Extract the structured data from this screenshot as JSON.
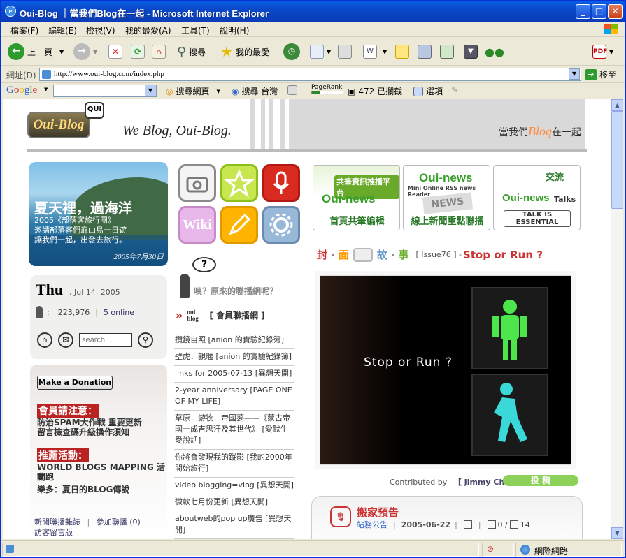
{
  "window": {
    "title": "Oui-Blog ｜當我們Blog在一起 - Microsoft Internet Explorer"
  },
  "menu": [
    "檔案(F)",
    "編輯(E)",
    "檢視(V)",
    "我的最愛(A)",
    "工具(T)",
    "說明(H)"
  ],
  "toolbar": {
    "back": "上一頁",
    "search": "搜尋",
    "favorites": "我的最愛"
  },
  "address": {
    "label": "網址(D)",
    "url": "http://www.oui-blog.com/index.php",
    "go": "移至"
  },
  "google": {
    "logo": "Google",
    "search_web": "搜尋網頁",
    "search_tw": "搜尋 台灣",
    "pagerank": "PageRank",
    "blocked": "472 已攔截",
    "options": "選項"
  },
  "status": {
    "zone": "網際網路"
  },
  "page": {
    "logo_text": "Oui-Blog",
    "logo_mark": "QUI",
    "slogan": "We Blog, Oui-Blog.",
    "tagline_pre": "當我們",
    "tagline_blog": "Blog",
    "tagline_post": "在一起",
    "banner": {
      "title": "夏天裡，過海洋",
      "line1": "2005《部落客旅行團》",
      "line2": "邀請部落客們龜山島一日遊",
      "line3": "讓我們一起，出發去旅行。",
      "date": "2005年7月30日"
    },
    "date": {
      "day": "Thu",
      "full": ", Jul 14, 2005",
      "users": "223,976",
      "online": "5 online",
      "search_placeholder": "search..."
    },
    "donate": "Make a Donation",
    "notice1_head": "會員請注意：",
    "notice1_line1": "防治SPAM大作戰 重要更新",
    "notice1_line2": "留言檢查碼升級操作須知",
    "notice2_head": "推薦活動：",
    "notice2_line1": "WORLD BLOGS MAPPING 活動",
    "notice2_line2": "開跑",
    "notice2_line3": "樂多：夏日的BLOG傳說",
    "left_link1": "新聞聯播雜誌",
    "left_link2": "參加聯播",
    "left_link2_count": "(0)",
    "left_link3": "訪客留言版",
    "tile_wiki": "Wiki",
    "question_mark": "?",
    "question": "咦？原來的聯播網呢？",
    "member_brand": "oui blog",
    "member_head": "[ 會員聯播網 ]",
    "posts": [
      "攬鏡自照 [anion 的實驗紀錄簿]",
      "壁虎．親暱 [anion 的實驗紀錄簿]",
      "links for 2005-07-13 [異想天開]",
      "2-year anniversary [PAGE ONE OF MY LIFE]",
      "草原．游牧．帝國夢——《蒙古帝國一成吉思汗及其世代》 [愛默生愛說話]",
      "你將會發現我的蹤影 [我的2000年開始旅行]",
      "video blogging=vlog [異想天開]",
      "微軟七月份更新 [異想天開]",
      "aboutweb的pop up廣告 [異想天開]"
    ],
    "btn1_tag": "共筆資訊推播平台",
    "btn1_big": "Oui-news",
    "btn1_bot": "首頁共筆編輯",
    "btn2_big": "Oui-news",
    "btn2_sub": "Mini Online RSS news Reader",
    "btn2_news": "NEWS",
    "btn2_bot": "線上新聞重點聯播",
    "btn3_tag": "交流",
    "btn3_big": "Oui-news",
    "btn3_talks": "Talks",
    "btn3_bot": "TALK IS ESSENTIAL",
    "cover_c1": "封",
    "cover_c2": "面",
    "cover_c3": "故",
    "cover_c4": "事",
    "issue": "[ Issue76 ] - ",
    "story_title": "Stop or Run ?",
    "photo_caption": "Stop or Run ?",
    "contrib_label": "Contributed by",
    "contrib_name": "【 Jimmy Chen 】",
    "submit": "投 稿",
    "news_title": "搬家預告",
    "news_cat": "站務公告",
    "news_date": "2005-06-22",
    "news_counts": "0 /",
    "news_comments": "14"
  }
}
